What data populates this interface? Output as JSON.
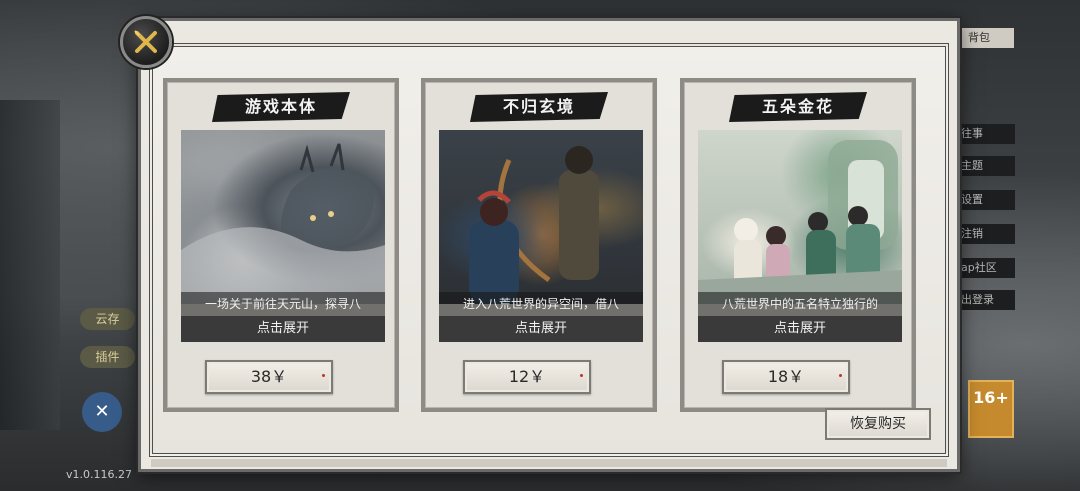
{
  "background": {
    "left_pills": [
      "云存",
      "插件"
    ],
    "right_menu": [
      "往事",
      "主题",
      "设置",
      "注销",
      "ap社区",
      "出登录"
    ],
    "right_header": "背包",
    "age_badge": "16+",
    "version": "v1.0.116.27"
  },
  "dialog": {
    "close_icon": "close-x-icon",
    "cards": [
      {
        "title": "游戏本体",
        "description": "一场关于前往天元山，探寻八",
        "expand_label": "点击展开",
        "price": "38￥"
      },
      {
        "title": "不归玄境",
        "description": "进入八荒世界的异空间，借八",
        "expand_label": "点击展开",
        "price": "12￥"
      },
      {
        "title": "五朵金花",
        "description": "八荒世界中的五名特立独行的",
        "expand_label": "点击展开",
        "price": "18￥"
      }
    ],
    "restore_label": "恢复购买"
  }
}
